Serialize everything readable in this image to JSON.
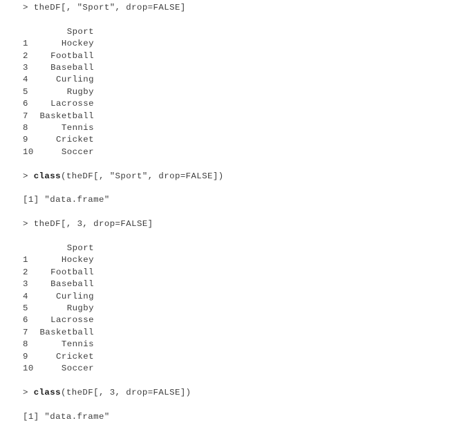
{
  "console": {
    "prompt_symbol": ">",
    "background_color": "#ffffff",
    "text_color": "#3d3d3d",
    "keyword_color": "#1a1a1a",
    "column_header": "Sport",
    "blocks": [
      {
        "kind": "input",
        "name": "command-select-sport-by-name",
        "prompt": ">",
        "keyword": "",
        "code": "theDF[, \"Sport\", drop=FALSE]"
      },
      {
        "kind": "blank",
        "name": "spacer"
      },
      {
        "kind": "table",
        "name": "output-dataframe-sport-by-name",
        "header": "Sport",
        "rows": [
          {
            "index": "1",
            "value": "Hockey"
          },
          {
            "index": "2",
            "value": "Football"
          },
          {
            "index": "3",
            "value": "Baseball"
          },
          {
            "index": "4",
            "value": "Curling"
          },
          {
            "index": "5",
            "value": "Rugby"
          },
          {
            "index": "6",
            "value": "Lacrosse"
          },
          {
            "index": "7",
            "value": "Basketball"
          },
          {
            "index": "8",
            "value": "Tennis"
          },
          {
            "index": "9",
            "value": "Cricket"
          },
          {
            "index": "10",
            "value": "Soccer"
          }
        ]
      },
      {
        "kind": "blank",
        "name": "spacer"
      },
      {
        "kind": "input",
        "name": "command-class-of-sport-by-name",
        "prompt": ">",
        "keyword": "class",
        "code": "(theDF[, \"Sport\", drop=FALSE])"
      },
      {
        "kind": "blank",
        "name": "spacer"
      },
      {
        "kind": "output",
        "name": "output-class-data-frame-1",
        "text": "[1] \"data.frame\""
      },
      {
        "kind": "blank",
        "name": "spacer"
      },
      {
        "kind": "input",
        "name": "command-select-sport-by-index",
        "prompt": ">",
        "keyword": "",
        "code": "theDF[, 3, drop=FALSE]"
      },
      {
        "kind": "blank",
        "name": "spacer"
      },
      {
        "kind": "table",
        "name": "output-dataframe-sport-by-index",
        "header": "Sport",
        "rows": [
          {
            "index": "1",
            "value": "Hockey"
          },
          {
            "index": "2",
            "value": "Football"
          },
          {
            "index": "3",
            "value": "Baseball"
          },
          {
            "index": "4",
            "value": "Curling"
          },
          {
            "index": "5",
            "value": "Rugby"
          },
          {
            "index": "6",
            "value": "Lacrosse"
          },
          {
            "index": "7",
            "value": "Basketball"
          },
          {
            "index": "8",
            "value": "Tennis"
          },
          {
            "index": "9",
            "value": "Cricket"
          },
          {
            "index": "10",
            "value": "Soccer"
          }
        ]
      },
      {
        "kind": "blank",
        "name": "spacer"
      },
      {
        "kind": "input",
        "name": "command-class-of-sport-by-index",
        "prompt": ">",
        "keyword": "class",
        "code": "(theDF[, 3, drop=FALSE])"
      },
      {
        "kind": "blank",
        "name": "spacer"
      },
      {
        "kind": "output",
        "name": "output-class-data-frame-2",
        "text": "[1] \"data.frame\""
      }
    ]
  }
}
